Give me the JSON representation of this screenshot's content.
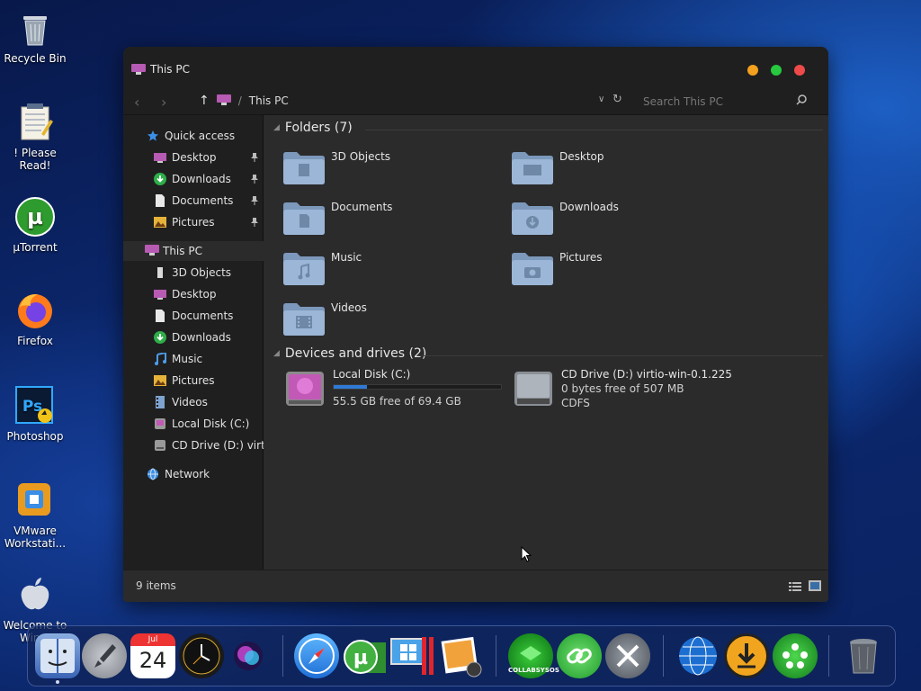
{
  "desktop": {
    "icons": [
      {
        "label": "Recycle Bin"
      },
      {
        "label": "! Please Read!"
      },
      {
        "label": "µTorrent"
      },
      {
        "label": "Firefox"
      },
      {
        "label": "Photoshop"
      },
      {
        "label": "VMware Workstati..."
      },
      {
        "label": "Welcome to Win..."
      }
    ]
  },
  "window": {
    "title": "This PC",
    "breadcrumb_sep": "/",
    "breadcrumb": "This PC",
    "search_placeholder": "Search This PC",
    "status": "9 items"
  },
  "sidebar": {
    "quick_access": "Quick access",
    "quick_items": [
      {
        "label": "Desktop"
      },
      {
        "label": "Downloads"
      },
      {
        "label": "Documents"
      },
      {
        "label": "Pictures"
      }
    ],
    "this_pc": "This PC",
    "pc_items": [
      {
        "label": "3D Objects"
      },
      {
        "label": "Desktop"
      },
      {
        "label": "Documents"
      },
      {
        "label": "Downloads"
      },
      {
        "label": "Music"
      },
      {
        "label": "Pictures"
      },
      {
        "label": "Videos"
      },
      {
        "label": "Local Disk (C:)"
      },
      {
        "label": "CD Drive (D:) virtio-"
      }
    ],
    "network": "Network"
  },
  "folders": {
    "header": "Folders (7)",
    "items": [
      {
        "name": "3D Objects"
      },
      {
        "name": "Desktop"
      },
      {
        "name": "Documents"
      },
      {
        "name": "Downloads"
      },
      {
        "name": "Music"
      },
      {
        "name": "Pictures"
      },
      {
        "name": "Videos"
      }
    ]
  },
  "drives": {
    "header": "Devices and drives (2)",
    "items": [
      {
        "name": "Local Disk (C:)",
        "free": "55.5 GB free of 69.4 GB",
        "used_fraction": 0.2
      },
      {
        "name": "CD Drive (D:) virtio-win-0.1.225",
        "free": "0 bytes free of 507 MB",
        "fs": "CDFS"
      }
    ]
  },
  "dock": {
    "calendar_month": "Jul",
    "calendar_day": "24",
    "collabsysos_label": "COLLABSYSOS"
  },
  "colors": {
    "accent": "#2e7ad6",
    "close": "#ee4a4a",
    "minimize": "#f3a11f",
    "maximize": "#27c93f",
    "folder": "#8eaed0"
  }
}
